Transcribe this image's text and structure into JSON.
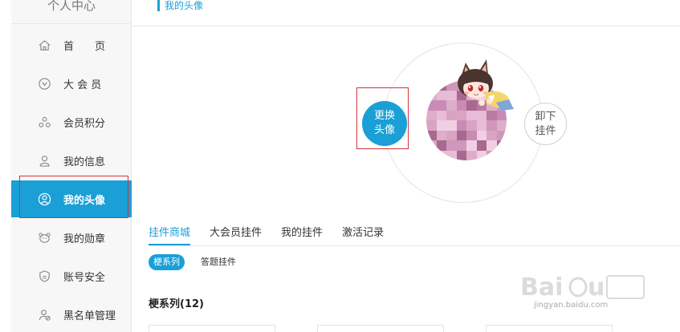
{
  "sidebar": {
    "title": "个人中心",
    "items": [
      {
        "label": "首　　页",
        "icon": "home-icon"
      },
      {
        "label": "大 会 员",
        "icon": "vip-icon"
      },
      {
        "label": "会员积分",
        "icon": "points-icon"
      },
      {
        "label": "我的信息",
        "icon": "user-icon"
      },
      {
        "label": "我的头像",
        "icon": "avatar-icon",
        "active": true
      },
      {
        "label": "我的勋章",
        "icon": "medal-icon"
      },
      {
        "label": "账号安全",
        "icon": "shield-icon"
      },
      {
        "label": "黑名单管理",
        "icon": "blacklist-icon"
      }
    ]
  },
  "breadcrumb": "我的头像",
  "avatar": {
    "change_line1": "更换",
    "change_line2": "头像",
    "remove_line1": "卸下",
    "remove_line2": "挂件"
  },
  "tabs": [
    "挂件商城",
    "大会员挂件",
    "我的挂件",
    "激活记录"
  ],
  "subtabs": [
    "梗系列",
    "答题挂件"
  ],
  "section_title": "梗系列(12)",
  "watermark": {
    "text": "jingyan.baidu.com"
  },
  "colors": {
    "accent": "#1a9fd6",
    "highlight": "#d0353c"
  }
}
